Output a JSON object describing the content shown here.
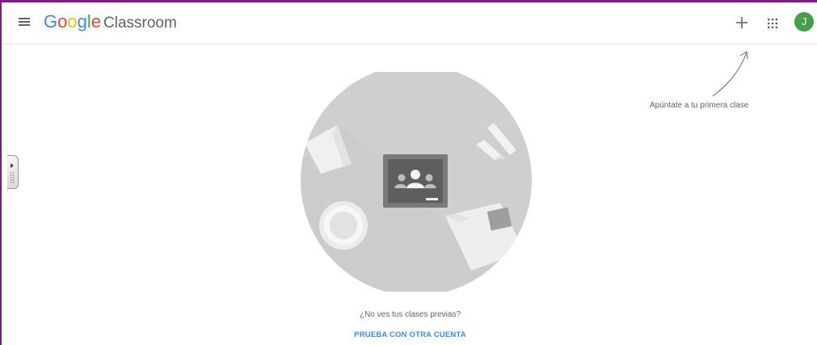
{
  "header": {
    "logo_letters": [
      "G",
      "o",
      "o",
      "g",
      "l",
      "e"
    ],
    "product_name": "Classroom",
    "avatar_initial": "J",
    "menu_icon": "hamburger-menu-icon",
    "add_icon": "plus-icon",
    "apps_icon": "apps-grid-icon"
  },
  "hint": {
    "text": "Apúntate a tu primera clase"
  },
  "empty_state": {
    "message": "¿No ves tus clases previas?",
    "link_label": "PRUEBA CON OTRA CUENTA"
  },
  "colors": {
    "frame_border": "#7b1e7a",
    "avatar_bg": "#43a047",
    "link": "#4285f4",
    "google_blue": "#4285f4",
    "google_red": "#ea4335",
    "google_yellow": "#fbbc05",
    "google_green": "#34a853"
  }
}
